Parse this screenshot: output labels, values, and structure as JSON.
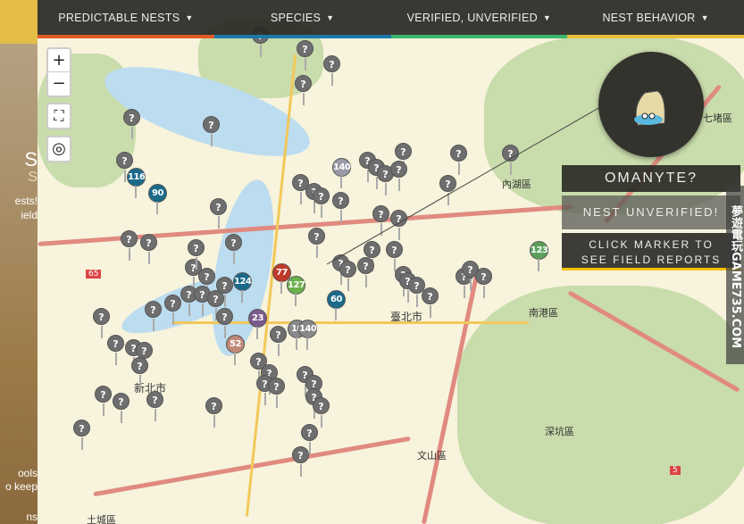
{
  "nav": [
    {
      "label": "PREDICTABLE NESTS",
      "color": "#e05a26"
    },
    {
      "label": "SPECIES",
      "color": "#1b78a8"
    },
    {
      "label": "VERIFIED, UNVERIFIED",
      "color": "#3bb56a"
    },
    {
      "label": "NEST BEHAVIOR",
      "color": "#e8bd3c"
    }
  ],
  "sidebar": {
    "line1": "S",
    "line2": "S",
    "line3": "ests!",
    "line4": "ield",
    "line5": "ools",
    "line6": "o keep",
    "line7": "ns"
  },
  "controls": {
    "zoom_in": "+",
    "zoom_out": "−",
    "fullscreen": "⛶",
    "locate": "◎"
  },
  "map_labels": {
    "district1": "新北市",
    "district2": "臺北市",
    "district3": "南港區",
    "district4": "文山區",
    "district5": "深坑區",
    "district6": "七堵區",
    "district7": "內湖區",
    "district8": "土城區",
    "road1": "5",
    "road2": "65"
  },
  "markers": {
    "unknown": "?",
    "numbered": [
      "116",
      "90",
      "140",
      "124",
      "77",
      "127",
      "60",
      "23",
      "52",
      "10",
      "140",
      "123"
    ]
  },
  "popup": {
    "species": "OMANYTE?",
    "status": "NEST UNVERIFIED!",
    "hint": "CLICK MARKER TO SEE FIELD REPORTS"
  },
  "watermark": "夢遊電玩GAME735.COM"
}
